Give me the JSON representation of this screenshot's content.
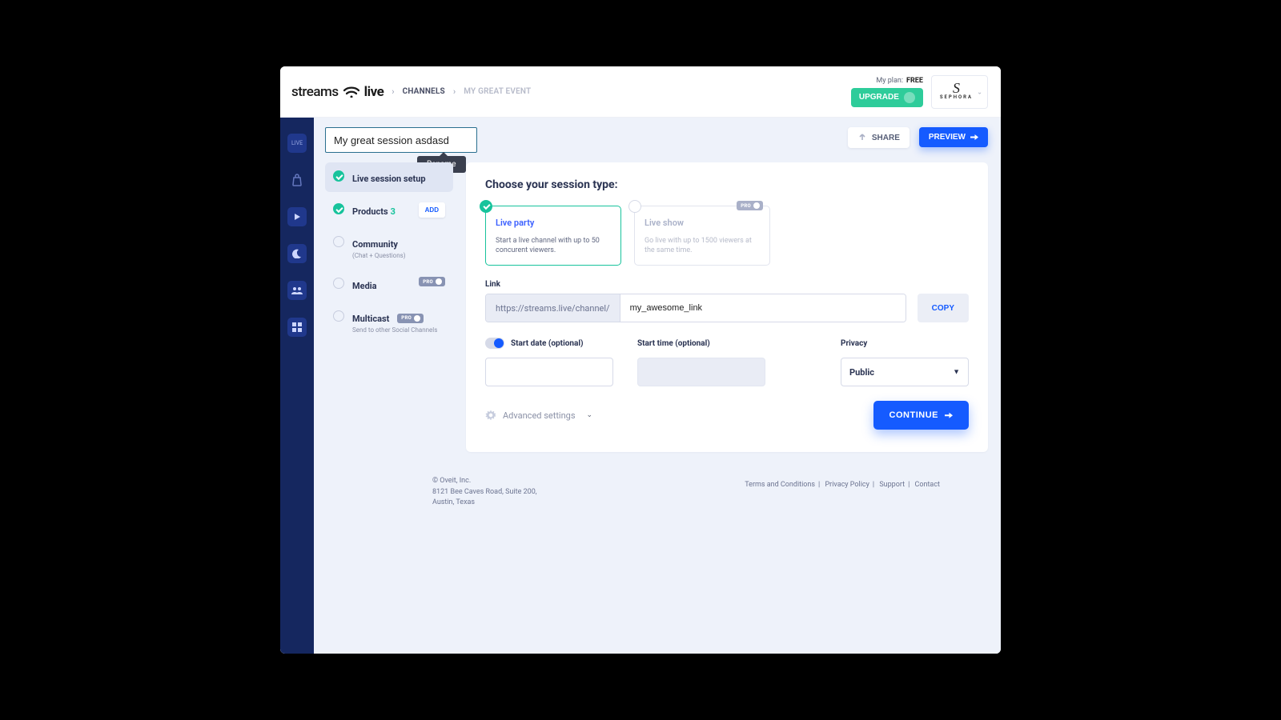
{
  "header": {
    "logo_text_a": "streams",
    "logo_text_b": "live",
    "breadcrumb1": "CHANNELS",
    "breadcrumb2": "MY GREAT EVENT",
    "plan_label": "My plan:",
    "plan_value": "FREE",
    "upgrade": "UPGRADE",
    "brand": "SEPHORA"
  },
  "rail": {
    "item1": "LIVE"
  },
  "topbar": {
    "title_value": "My great session asdasd",
    "tooltip": "Rename",
    "share": "SHARE",
    "preview": "PREVIEW"
  },
  "steps": {
    "s1": "Live session setup",
    "s2_label": "Products",
    "s2_count": "3",
    "s2_add": "ADD",
    "s3_label": "Community",
    "s3_sub": "(Chat + Questions)",
    "s4_label": "Media",
    "s5_label": "Multicast",
    "s5_sub": "Send to other Social Channels",
    "pro": "PRO"
  },
  "panel": {
    "heading": "Choose your session type:",
    "card1_title": "Live party",
    "card1_desc": "Start a live channel with up to 50 concurent viewers.",
    "card2_title": "Live show",
    "card2_desc": "Go live with up to 1500 viewers at the same time.",
    "link_label": "Link",
    "link_prefix": "https://streams.live/channel/",
    "link_value": "my_awesome_link",
    "copy": "COPY",
    "start_date_label": "Start date (optional)",
    "start_time_label": "Start time (optional)",
    "privacy_label": "Privacy",
    "privacy_value": "Public",
    "adv": "Advanced settings",
    "continue": "CONTINUE"
  },
  "footer": {
    "c1": "© Oveit, Inc.",
    "c2": "8121 Bee Caves Road, Suite 200,",
    "c3": "Austin, Texas",
    "l1": "Terms and Conditions",
    "l2": "Privacy Policy",
    "l3": "Support",
    "l4": "Contact"
  }
}
